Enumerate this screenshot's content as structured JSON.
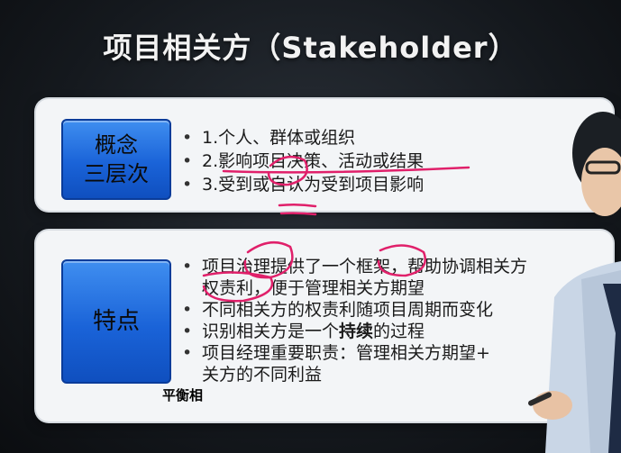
{
  "slide": {
    "title": "项目相关方（Stakeholder）",
    "caption": "平衡相"
  },
  "concept": {
    "tag_line1": "概念",
    "tag_line2": "三层次",
    "items": [
      "1.个人、群体或组织",
      "2.影响项目决策、活动或结果",
      "3.受到或自认为受到项目影响"
    ]
  },
  "features": {
    "tag": "特点",
    "items": [
      "项目治理提供了一个框架，帮助协调相关方",
      "不同相关方的权责利随项目周期而变化",
      "识别相关方是一个",
      "项目经理重要职责：管理相关方期望+"
    ],
    "item1_cont": "权责利，便于管理相关方期望",
    "item3_bold": "持续",
    "item3_tail": "的过程",
    "item4_cont": "关方的不同利益"
  },
  "colors": {
    "tag_blue": "#1a63d8",
    "annotation": "#e0206a",
    "card_bg": "#f3f5f7"
  },
  "icons": {
    "bullet": "bullet-dot-icon",
    "presenter": "presenter-figure-icon"
  }
}
